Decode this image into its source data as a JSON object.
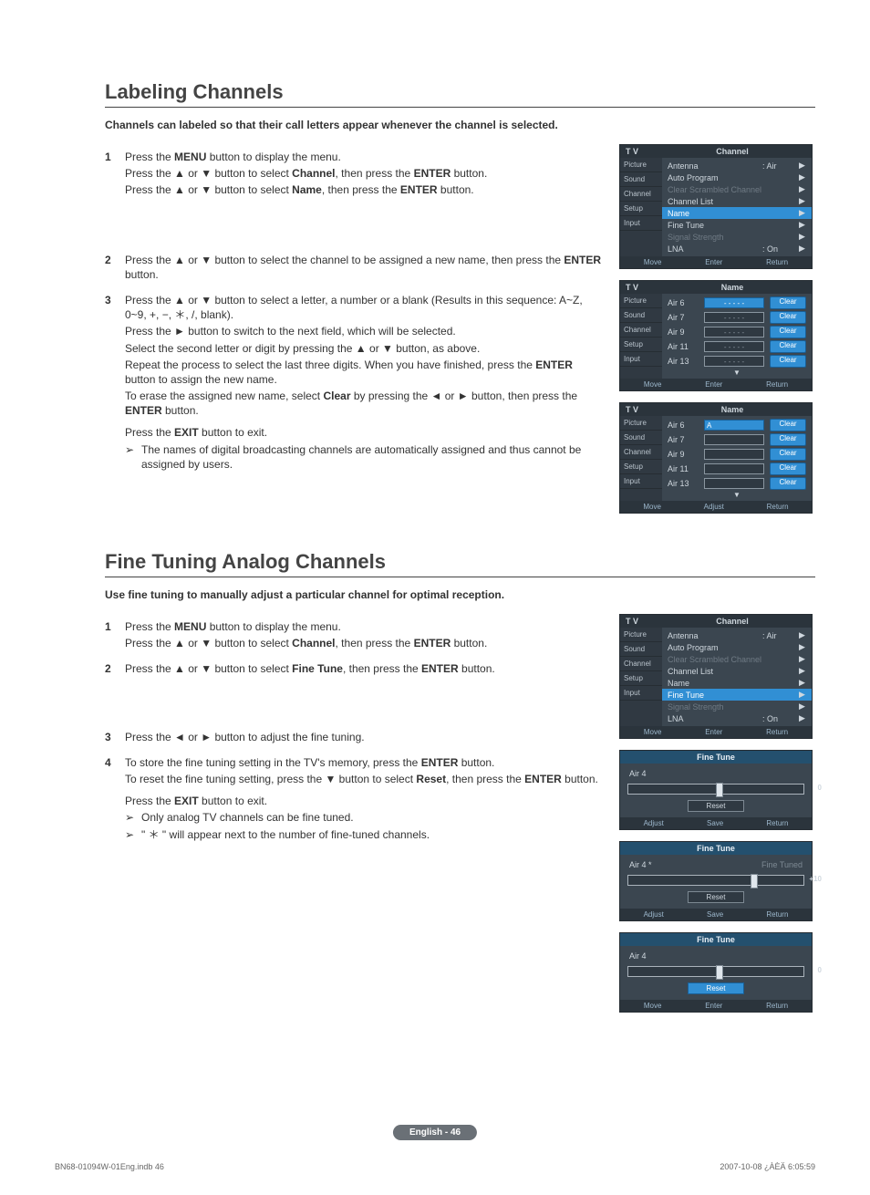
{
  "sec1": {
    "title": "Labeling Channels",
    "intro": "Channels can labeled so that their call letters appear whenever the channel is selected.",
    "s1": {
      "n": "1",
      "l1": "Press the MENU button to display the menu.",
      "l2": "Press the ▲ or ▼ button to select Channel, then press the ENTER button.",
      "l3": "Press the ▲ or ▼ button to select Name, then press the ENTER button."
    },
    "s2": {
      "n": "2",
      "l1": "Press the ▲ or ▼ button to select the channel to be assigned a new name, then press the ENTER button."
    },
    "s3": {
      "n": "3",
      "l1": "Press the ▲ or ▼ button to select a letter, a number or a blank (Results in this sequence: A~Z, 0~9, +, −, ＊, /, blank).",
      "l2": "Press the ► button to switch to the next field, which will be selected.",
      "l3": "Select the second letter or digit by pressing the ▲ or ▼ button, as above.",
      "l4": "Repeat the process to select the last three digits. When you have finished, press the ENTER button to assign the new name.",
      "l5": "To erase the assigned new name, select Clear by pressing the ◄ or ► button, then press the ENTER button.",
      "l6": "Press the EXIT button to exit.",
      "note1": "The names of digital broadcasting channels are automatically assigned and thus cannot be assigned by users."
    }
  },
  "sec2": {
    "title": "Fine Tuning Analog Channels",
    "intro": "Use fine tuning to manually adjust a particular channel for optimal reception.",
    "s1": {
      "n": "1",
      "l1": "Press the MENU button to display the menu.",
      "l2": "Press the ▲ or ▼ button to select Channel, then press the ENTER button."
    },
    "s2": {
      "n": "2",
      "l1": "Press the ▲ or ▼ button to select Fine Tune, then press the ENTER button."
    },
    "s3": {
      "n": "3",
      "l1": "Press the ◄ or ► button to adjust the fine tuning."
    },
    "s4": {
      "n": "4",
      "l1": "To store the fine tuning setting in the TV's memory, press the ENTER button.",
      "l2": "To reset the fine tuning setting, press the ▼ button to select Reset, then press the ENTER button.",
      "l3": "Press the EXIT button to exit.",
      "note1": "Only analog TV channels can be fine tuned.",
      "note2": "\" ＊ \" will appear next to the number of fine-tuned channels."
    }
  },
  "osd": {
    "tv": "T V",
    "side": [
      "Picture",
      "Sound",
      "Channel",
      "Setup",
      "Input"
    ],
    "chTtl": "Channel",
    "nmTtl": "Name",
    "ftTtl": "Fine Tune",
    "chMenu": [
      {
        "l": "Antenna",
        "v": ": Air"
      },
      {
        "l": "Auto Program"
      },
      {
        "l": "Clear Scrambled Channel",
        "dim": true
      },
      {
        "l": "Channel List"
      },
      {
        "l": "Name",
        "hl": true
      },
      {
        "l": "Fine Tune"
      },
      {
        "l": "Signal Strength",
        "dim": true
      },
      {
        "l": "LNA",
        "v": ": On"
      }
    ],
    "legend1": [
      "Move",
      "Enter",
      "Return"
    ],
    "legend2": [
      "Move",
      "Adjust",
      "Return"
    ],
    "names": [
      "Air 6",
      "Air 7",
      "Air 9",
      "Air 11",
      "Air 13"
    ],
    "dash": "- - - - -",
    "letterA": "A",
    "clear": "Clear",
    "chMenu2": [
      {
        "l": "Antenna",
        "v": ": Air"
      },
      {
        "l": "Auto Program"
      },
      {
        "l": "Clear Scrambled Channel",
        "dim": true
      },
      {
        "l": "Channel List"
      },
      {
        "l": "Name"
      },
      {
        "l": "Fine Tune",
        "hl": true
      },
      {
        "l": "Signal Strength",
        "dim": true
      },
      {
        "l": "LNA",
        "v": ": On"
      }
    ],
    "ft": {
      "ch": "Air  4",
      "ch2": "Air  4 *",
      "tuned": "Fine Tuned",
      "v0": "0",
      "v10": "+10",
      "reset": "Reset",
      "leg1": [
        "Adjust",
        "Save",
        "Return"
      ],
      "leg2": [
        "Move",
        "Enter",
        "Return"
      ]
    }
  },
  "footer": {
    "pill": "English - 46",
    "l": "BN68-01094W-01Eng.indb   46",
    "r": "2007-10-08   ¿ÀÈÄ 6:05:59"
  }
}
